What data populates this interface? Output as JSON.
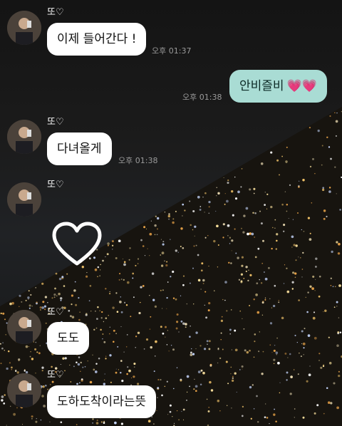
{
  "chat": {
    "messages": [
      {
        "sender": "또♡",
        "text": "이제 들어간다 !",
        "time": "오후 01:37"
      },
      {
        "sender": "me",
        "text": "안비즐비",
        "emoji": "💗💗",
        "time": "오후 01:38"
      },
      {
        "sender": "또♡",
        "text": "다녀올게",
        "time": "오후 01:38"
      },
      {
        "sender": "또♡",
        "sticker": "heart-outline"
      },
      {
        "sender": "또♡",
        "text": "도도"
      },
      {
        "sender": "또♡",
        "text": "도하도착이라는뜻"
      }
    ]
  },
  "colors": {
    "my_bubble": "#a9dcd4",
    "their_bubble": "#ffffff",
    "background": "#1a1a1a"
  }
}
